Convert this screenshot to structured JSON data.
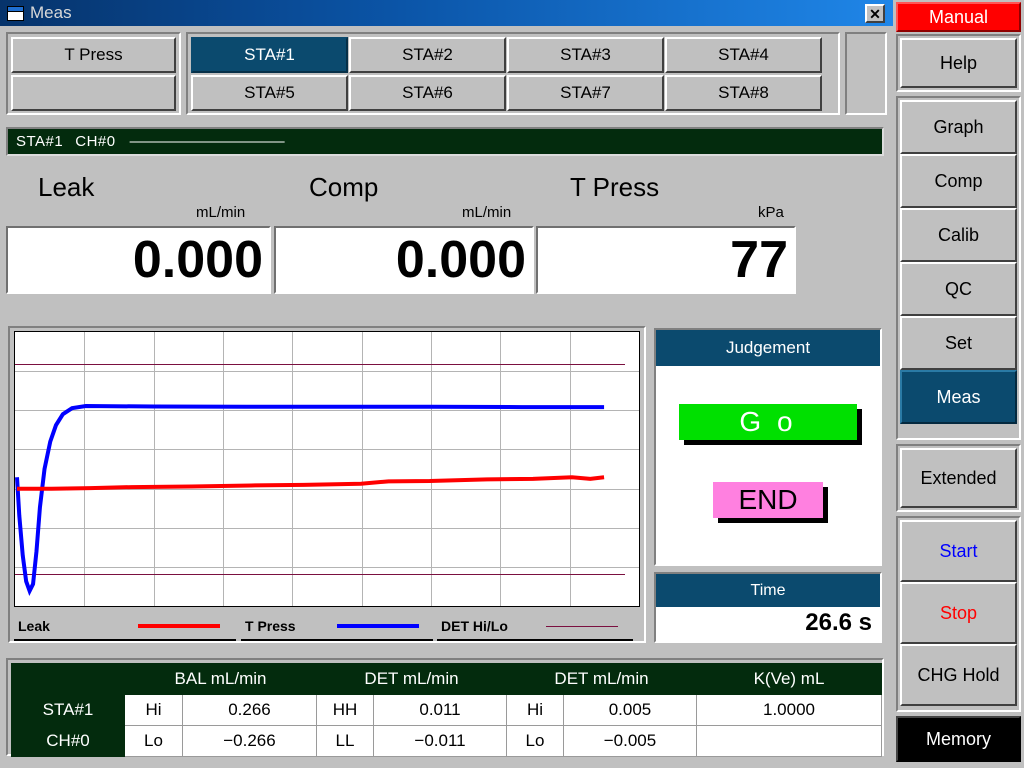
{
  "window": {
    "title": "Meas",
    "icon": "window-icon",
    "close_label": "✕"
  },
  "tabs": {
    "left": [
      {
        "label": "T Press",
        "selected": false
      },
      {
        "label": "",
        "selected": false
      }
    ],
    "stations_row1": [
      {
        "label": "STA#1",
        "selected": true
      },
      {
        "label": "STA#2",
        "selected": false
      },
      {
        "label": "STA#3",
        "selected": false
      },
      {
        "label": "STA#4",
        "selected": false
      }
    ],
    "stations_row2": [
      {
        "label": "STA#5",
        "selected": false
      },
      {
        "label": "STA#6",
        "selected": false
      },
      {
        "label": "STA#7",
        "selected": false
      },
      {
        "label": "STA#8",
        "selected": false
      }
    ]
  },
  "status": {
    "station": "STA#1",
    "channel": "CH#0",
    "dashes": "———————————"
  },
  "readouts": [
    {
      "label": "Leak",
      "unit": "mL/min",
      "value": "0.000"
    },
    {
      "label": "Comp",
      "unit": "mL/min",
      "value": "0.000"
    },
    {
      "label": "T Press",
      "unit": "kPa",
      "value": "77"
    }
  ],
  "judgement": {
    "header": "Judgement",
    "result": "G o",
    "result_color": "#00e000",
    "state": "END",
    "state_color": "#ff80e0"
  },
  "time": {
    "header": "Time",
    "value": "26.6 s"
  },
  "table": {
    "headers": [
      "",
      "BAL  mL/min",
      "DET  mL/min",
      "DET  mL/min",
      "K(Ve)  mL"
    ],
    "rows": [
      {
        "name": "STA#1",
        "bal_key": "Hi",
        "bal_val": "0.266",
        "det1_key": "HH",
        "det1_val": "0.011",
        "det2_key": "Hi",
        "det2_val": "0.005",
        "kve": "1.0000"
      },
      {
        "name": "CH#0",
        "bal_key": "Lo",
        "bal_val": "−0.266",
        "det1_key": "LL",
        "det1_val": "−0.011",
        "det2_key": "Lo",
        "det2_val": "−0.005",
        "kve": ""
      }
    ]
  },
  "sidebar": {
    "mode": {
      "label": "Manual",
      "color": "#ff0000"
    },
    "group1": [
      {
        "label": "Help",
        "selected": false
      }
    ],
    "group2": [
      {
        "label": "Graph",
        "selected": false
      },
      {
        "label": "Comp",
        "selected": false
      },
      {
        "label": "Calib",
        "selected": false
      },
      {
        "label": "QC",
        "selected": false
      },
      {
        "label": "Set",
        "selected": false
      },
      {
        "label": "Meas",
        "selected": true
      }
    ],
    "group3": [
      {
        "label": "Extended",
        "selected": false
      }
    ],
    "group4": [
      {
        "label": "Start",
        "selected": false,
        "style": "start"
      },
      {
        "label": "Stop",
        "selected": false,
        "style": "stop"
      },
      {
        "label": "CHG Hold",
        "selected": false,
        "style": ""
      }
    ],
    "memory": {
      "label": "Memory"
    }
  },
  "chart_data": {
    "type": "line",
    "title": "",
    "xlabel": "",
    "ylabel": "",
    "xlim": [
      0,
      26.6
    ],
    "ylim": [
      0,
      1
    ],
    "grid": true,
    "legend_position": "bottom",
    "background": "#ffffff",
    "vertical_gridlines": 8,
    "horizontal_gridlines": 6,
    "legend": [
      {
        "name": "Leak",
        "color": "#ff0000",
        "width": 4
      },
      {
        "name": "T Press",
        "color": "#0000ff",
        "width": 4
      },
      {
        "name": "DET Hi/Lo",
        "color": "#7b1040",
        "width": 1
      }
    ],
    "threshold_lines": [
      {
        "name": "DET Hi",
        "y": 0.885,
        "color": "#7b1040"
      },
      {
        "name": "DET Lo",
        "y": 0.115,
        "color": "#7b1040"
      }
    ],
    "series": [
      {
        "name": "T Press",
        "color": "#0000ff",
        "x": [
          0.0,
          0.1,
          0.25,
          0.4,
          0.55,
          0.7,
          0.85,
          1.0,
          1.2,
          1.45,
          1.7,
          2.0,
          2.4,
          3.0,
          6.0,
          10.0,
          14.0,
          18.0,
          22.0,
          25.6
        ],
        "y": [
          0.47,
          0.33,
          0.185,
          0.09,
          0.055,
          0.08,
          0.2,
          0.36,
          0.5,
          0.6,
          0.66,
          0.7,
          0.722,
          0.73,
          0.728,
          0.727,
          0.727,
          0.727,
          0.726,
          0.726
        ]
      },
      {
        "name": "Leak",
        "color": "#ff0000",
        "x": [
          0.0,
          1.5,
          3.2,
          5.0,
          7.6,
          10.2,
          12.5,
          15.0,
          16.2,
          18.0,
          20.5,
          22.5,
          24.2,
          25.0,
          25.6
        ],
        "y": [
          0.428,
          0.428,
          0.43,
          0.434,
          0.436,
          0.44,
          0.442,
          0.446,
          0.455,
          0.456,
          0.462,
          0.464,
          0.47,
          0.464,
          0.47
        ]
      }
    ]
  }
}
